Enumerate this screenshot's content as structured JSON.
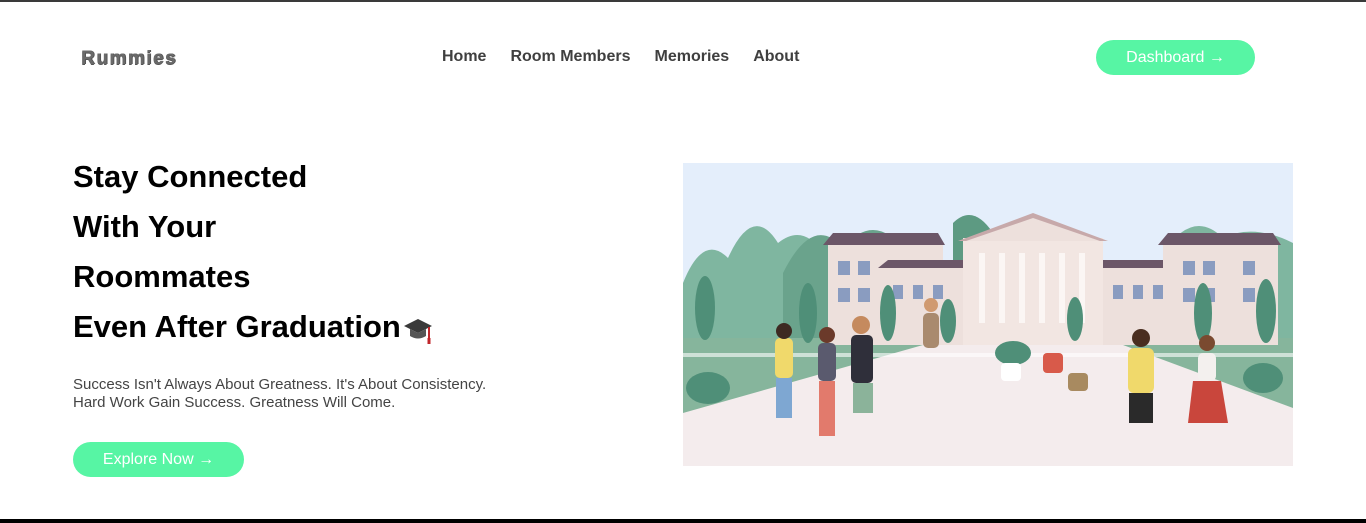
{
  "brand": {
    "logo": "Rummies"
  },
  "nav": {
    "items": [
      {
        "label": "Home"
      },
      {
        "label": "Room Members"
      },
      {
        "label": "Memories"
      },
      {
        "label": "About"
      }
    ]
  },
  "header": {
    "dashboard_label": "Dashboard →"
  },
  "hero": {
    "title_lines": [
      "Stay Connected",
      "With Your",
      "Roommates",
      "Even After Graduation"
    ],
    "subtitle_lines": [
      "Success Isn't Always About Greatness. It's About Consistency.",
      "Hard Work Gain Success. Greatness Will Come."
    ],
    "cta_label": "Explore Now →",
    "title_icon": "graduation-cap-icon"
  },
  "colors": {
    "accent": "#57f5a4",
    "sky": "#e4eefb",
    "building": "#ede0dc",
    "roof": "#6c5768",
    "grass": "#86b59c",
    "trees": "#4f8f78"
  }
}
